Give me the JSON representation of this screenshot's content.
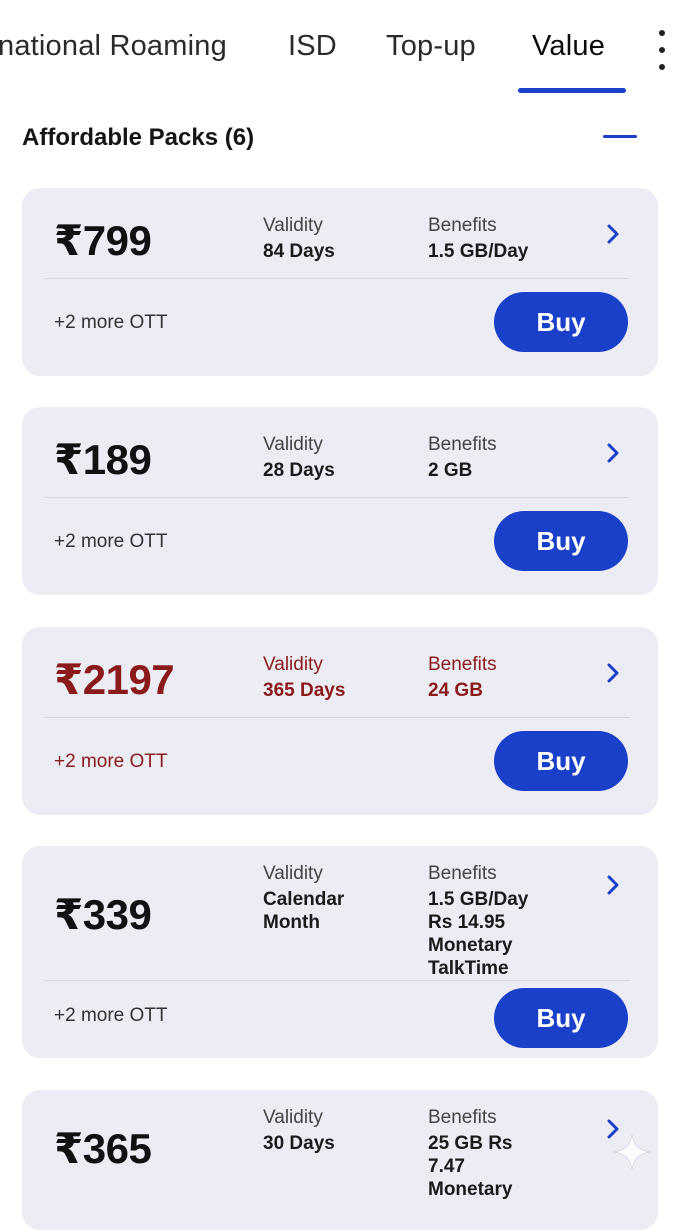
{
  "tabs": [
    {
      "label": "national Roaming"
    },
    {
      "label": "ISD"
    },
    {
      "label": "Top-up"
    },
    {
      "label": "Value"
    }
  ],
  "active_tab": "Value",
  "section": {
    "title": "Affordable Packs (6)"
  },
  "colors": {
    "accent": "#1a3fc9",
    "highlight_red": "#8b1a1a",
    "card_bg": "#ececf5"
  },
  "icons": {
    "more": "vertical-ellipsis",
    "collapse": "minus",
    "card_arrow": "chevron-right",
    "corner": "sparkle"
  },
  "packs": [
    {
      "price": "₹799",
      "validity_label": "Validity",
      "validity": "84 Days",
      "benefits_label": "Benefits",
      "benefits": "1.5 GB/Day",
      "ott": "+2 more OTT",
      "buy_label": "Buy"
    },
    {
      "price": "₹189",
      "validity_label": "Validity",
      "validity": "28 Days",
      "benefits_label": "Benefits",
      "benefits": "2 GB",
      "ott": "+2 more OTT",
      "buy_label": "Buy"
    },
    {
      "price": "₹2197",
      "validity_label": "Validity",
      "validity": "365 Days",
      "benefits_label": "Benefits",
      "benefits": "24 GB",
      "ott": "+2 more OTT",
      "buy_label": "Buy",
      "highlight": true
    },
    {
      "price": "₹339",
      "validity_label": "Validity",
      "validity": "Calendar Month",
      "benefits_label": "Benefits",
      "benefits": "1.5 GB/Day Rs 14.95 Monetary TalkTime",
      "ott": "+2 more OTT",
      "buy_label": "Buy"
    },
    {
      "price": "₹365",
      "validity_label": "Validity",
      "validity": "30 Days",
      "benefits_label": "Benefits",
      "benefits": "25 GB Rs 7.47 Monetary"
    }
  ]
}
